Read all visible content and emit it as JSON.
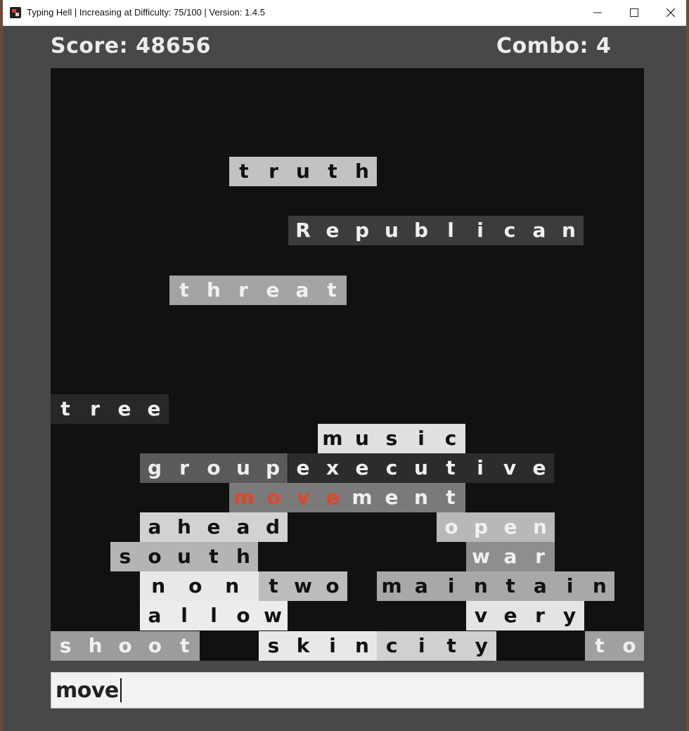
{
  "window": {
    "title": "Typing Hell | Increasing at Difficulty: 75/100 | Version: 1.4.5",
    "controls": {
      "minimize": "minimize-icon",
      "maximize": "maximize-icon",
      "close": "close-icon"
    }
  },
  "hud": {
    "score_label": "Score: 48656",
    "combo_label": "Combo: 4"
  },
  "words": [
    {
      "text": "truth",
      "bg": "#c2c2c2",
      "fg": "dark",
      "typed": 0
    },
    {
      "text": "Republican",
      "bg": "#3c3c3c",
      "fg": "light",
      "typed": 0
    },
    {
      "text": "threat",
      "bg": "#a4a4a4",
      "fg": "light",
      "typed": 0
    },
    {
      "text": "tree",
      "bg": "#282828",
      "fg": "light",
      "typed": 0
    },
    {
      "text": "music",
      "bg": "#e0e0e0",
      "fg": "dark",
      "typed": 0
    },
    {
      "text": "group",
      "bg": "#5a5a5a",
      "fg": "light",
      "typed": 0
    },
    {
      "text": "executive",
      "bg": "#2c2c2c",
      "fg": "light",
      "typed": 0
    },
    {
      "text": "movement",
      "bg": "#7a7a7a",
      "fg": "light",
      "typed": 4
    },
    {
      "text": "ahead",
      "bg": "#d2d2d2",
      "fg": "dark",
      "typed": 0
    },
    {
      "text": "open",
      "bg": "#b8b8b8",
      "fg": "light",
      "typed": 0
    },
    {
      "text": "south",
      "bg": "#b4b4b4",
      "fg": "dark",
      "typed": 0
    },
    {
      "text": "war",
      "bg": "#8e8e8e",
      "fg": "light",
      "typed": 0
    },
    {
      "text": "none",
      "bg": "#e8e8e8",
      "fg": "dark",
      "typed": 0
    },
    {
      "text": "two",
      "bg": "#bcbcbc",
      "fg": "dark",
      "typed": 0
    },
    {
      "text": "maintain",
      "bg": "#a8a8a8",
      "fg": "dark",
      "typed": 0
    },
    {
      "text": "allow",
      "bg": "#ececec",
      "fg": "dark",
      "typed": 0
    },
    {
      "text": "very",
      "bg": "#e4e4e4",
      "fg": "dark",
      "typed": 0
    },
    {
      "text": "shoot",
      "bg": "#9c9c9c",
      "fg": "light",
      "typed": 0
    },
    {
      "text": "skin",
      "bg": "#e8e8e8",
      "fg": "dark",
      "typed": 0
    },
    {
      "text": "city",
      "bg": "#d0d0d0",
      "fg": "dark",
      "typed": 0
    },
    {
      "text": "to",
      "bg": "#a0a0a0",
      "fg": "light",
      "typed": 0
    }
  ],
  "input": {
    "value": "move"
  }
}
